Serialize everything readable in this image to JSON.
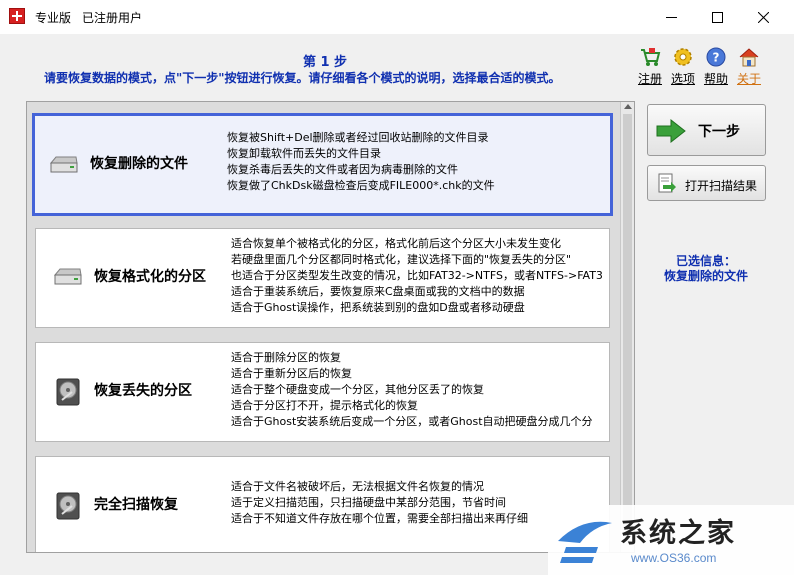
{
  "window": {
    "title_edition": "专业版",
    "title_status": "已注册用户"
  },
  "header": {
    "step_title": "第 1 步",
    "step_desc": "请要恢复数据的模式，点\"下一步\"按钮进行恢复。请仔细看各个模式的说明，选择最合适的模式。",
    "tools": [
      {
        "label": "注册",
        "icon": "cart-icon",
        "color": "#000000"
      },
      {
        "label": "选项",
        "icon": "gear-icon",
        "color": "#000000"
      },
      {
        "label": "帮助",
        "icon": "help-icon",
        "color": "#000000"
      },
      {
        "label": "关于",
        "icon": "home-icon",
        "color": "#d07010"
      }
    ]
  },
  "modes": [
    {
      "title": "恢复删除的文件",
      "icon": "drive-icon",
      "selected": true,
      "lines": [
        "恢复被Shift+Del删除或者经过回收站删除的文件目录",
        "恢复卸载软件而丢失的文件目录",
        "恢复杀毒后丢失的文件或者因为病毒删除的文件",
        "恢复做了ChkDsk磁盘检查后变成FILE000*.chk的文件"
      ]
    },
    {
      "title": "恢复格式化的分区",
      "icon": "drive-icon",
      "selected": false,
      "lines": [
        "适合恢复单个被格式化的分区，格式化前后这个分区大小未发生变化",
        "若硬盘里面几个分区都同时格式化，建议选择下面的\"恢复丢失的分区\"",
        "也适合于分区类型发生改变的情况，比如FAT32->NTFS，或者NTFS->FAT3",
        "适合于重装系统后，要恢复原来C盘桌面或我的文档中的数据",
        "适合于Ghost误操作，把系统装到别的盘如D盘或者移动硬盘"
      ]
    },
    {
      "title": "恢复丢失的分区",
      "icon": "harddisk-icon",
      "selected": false,
      "lines": [
        "适合于删除分区的恢复",
        "适合于重新分区后的恢复",
        "适合于整个硬盘变成一个分区，其他分区丢了的恢复",
        "适合于分区打不开，提示格式化的恢复",
        "适合于Ghost安装系统后变成一个分区，或者Ghost自动把硬盘分成几个分"
      ]
    },
    {
      "title": "完全扫描恢复",
      "icon": "harddisk-icon",
      "selected": false,
      "lines": [
        "适合于文件名被破坏后，无法根据文件名恢复的情况",
        "适于定义扫描范围，只扫描硬盘中某部分范围，节省时间",
        "适合于不知道文件存放在哪个位置，需要全部扫描出来再仔细"
      ]
    }
  ],
  "buttons": {
    "next": "下一步",
    "open_scan": "打开扫描结果"
  },
  "selected_info": {
    "label": "已选信息：",
    "value": "恢复删除的文件"
  },
  "watermark": {
    "name": "系统之家",
    "url": "www.OS36.com"
  },
  "colors": {
    "accent_blue": "#1030b0",
    "selection_border": "#4463d8",
    "about_orange": "#d07010"
  }
}
